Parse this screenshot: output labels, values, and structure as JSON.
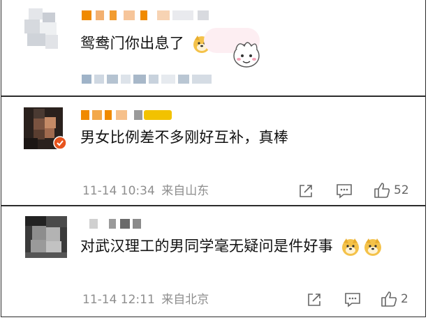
{
  "colors": {
    "text": "#111111",
    "meta": "#8e8e8e",
    "border": "#2b2b2b",
    "vip_orange": "#f08a00",
    "vip_gold": "#f2c200",
    "badge_red": "#e8541e"
  },
  "comments": [
    {
      "text": "鸳鸯门你出息了",
      "emoji": [
        "doge-icon"
      ],
      "sticker": "sticker-icon"
    },
    {
      "text": "男女比例差不多刚好互补，真棒",
      "time": "11-14 10:34",
      "location": "来自山东",
      "likes": "52",
      "icons": [
        "share-icon",
        "comment-icon",
        "like-icon"
      ]
    },
    {
      "text": "对武汉理工的男同学毫无疑问是件好事",
      "emoji": [
        "doge-icon",
        "doge-icon"
      ],
      "time": "11-14 12:11",
      "location": "来自北京",
      "likes": "2",
      "icons": [
        "share-icon",
        "comment-icon",
        "like-icon"
      ]
    }
  ]
}
